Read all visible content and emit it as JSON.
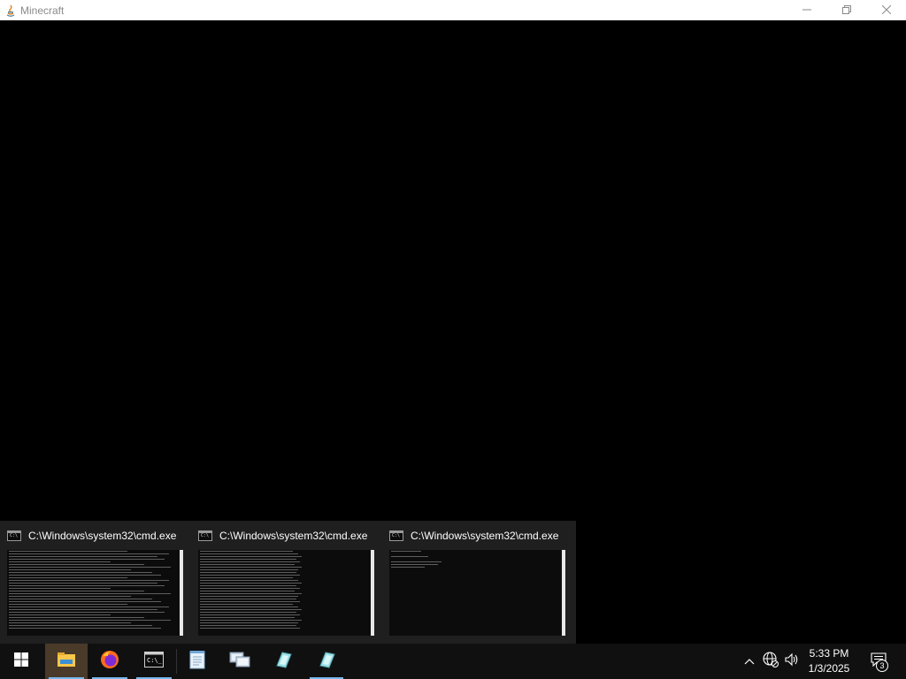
{
  "window": {
    "title": "Minecraft",
    "app_icon": "java-icon",
    "controls": [
      "minimize-icon",
      "restore-icon",
      "close-icon"
    ]
  },
  "thumbnails": [
    {
      "title": "C:\\Windows\\system32\\cmd.exe",
      "icon": "cmd-icon"
    },
    {
      "title": "C:\\Windows\\system32\\cmd.exe",
      "icon": "cmd-icon"
    },
    {
      "title": "C:\\Windows\\system32\\cmd.exe",
      "icon": "cmd-icon"
    }
  ],
  "taskbar": {
    "pinned": [
      {
        "icon": "windows-start-icon"
      },
      {
        "icon": "file-explorer-icon"
      },
      {
        "icon": "firefox-icon"
      },
      {
        "icon": "command-prompt-icon"
      },
      {
        "icon": "notepad-icon"
      },
      {
        "icon": "remote-desktop-icon"
      },
      {
        "icon": "java-icon"
      },
      {
        "icon": "java-icon"
      }
    ],
    "accent_color": "#76b9ed"
  },
  "tray": {
    "time": "5:33 PM",
    "date": "1/3/2025",
    "notification_count": "3",
    "icons": [
      "chevron-up-icon",
      "network-icon",
      "volume-icon",
      "action-center-icon"
    ]
  }
}
